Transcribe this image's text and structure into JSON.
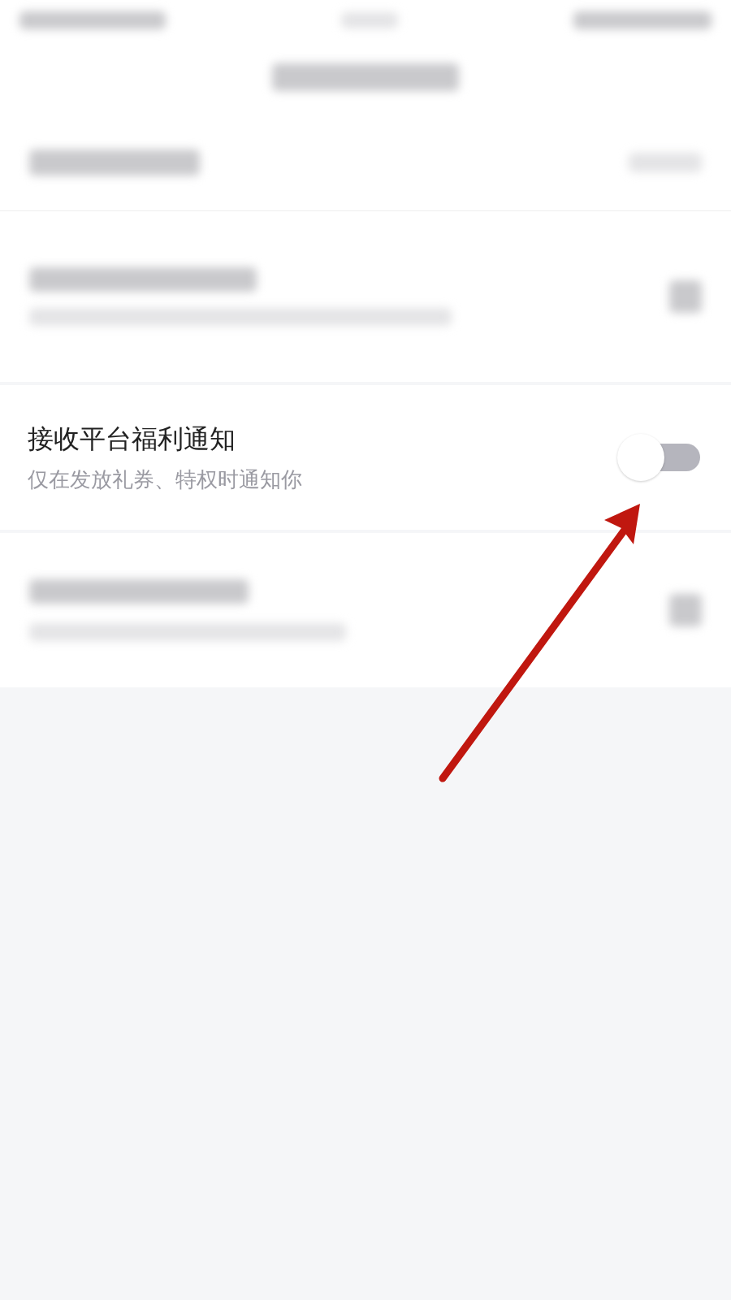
{
  "setting": {
    "title": "接收平台福利通知",
    "description": "仅在发放礼券、特权时通知你",
    "on": false
  }
}
